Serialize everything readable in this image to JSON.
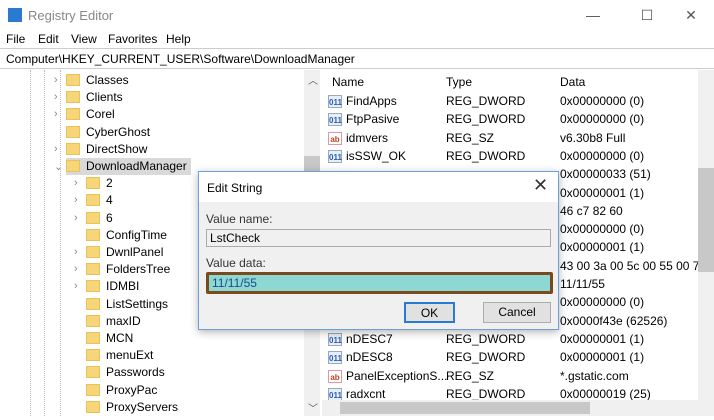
{
  "window": {
    "title": "Registry Editor",
    "minimize": "—",
    "maximize": "☐",
    "close": "✕",
    "icon": "registry-icon"
  },
  "menu": [
    {
      "label": "File"
    },
    {
      "label": "Edit"
    },
    {
      "label": "View"
    },
    {
      "label": "Favorites"
    },
    {
      "label": "Help"
    }
  ],
  "address": "Computer\\HKEY_CURRENT_USER\\Software\\DownloadManager",
  "tree": [
    {
      "label": "Classes",
      "expandable": true
    },
    {
      "label": "Clients",
      "expandable": true
    },
    {
      "label": "Corel",
      "expandable": true
    },
    {
      "label": "CyberGhost",
      "expandable": false
    },
    {
      "label": "DirectShow",
      "expandable": true
    },
    {
      "label": "DownloadManager",
      "expanded": true,
      "selected": true
    },
    {
      "label": "2",
      "expandable": true,
      "child": true
    },
    {
      "label": "4",
      "expandable": true,
      "child": true
    },
    {
      "label": "6",
      "expandable": true,
      "child": true
    },
    {
      "label": "ConfigTime",
      "child": true
    },
    {
      "label": "DwnlPanel",
      "expandable": true,
      "child": true
    },
    {
      "label": "FoldersTree",
      "expandable": true,
      "child": true
    },
    {
      "label": "IDMBI",
      "expandable": true,
      "child": true
    },
    {
      "label": "ListSettings",
      "child": true
    },
    {
      "label": "maxID",
      "child": true
    },
    {
      "label": "MCN",
      "child": true
    },
    {
      "label": "menuExt",
      "child": true
    },
    {
      "label": "Passwords",
      "child": true
    },
    {
      "label": "ProxyPac",
      "child": true
    },
    {
      "label": "ProxyServers",
      "child": true
    }
  ],
  "list": {
    "headers": {
      "name": "Name",
      "type": "Type",
      "data": "Data"
    },
    "rows": [
      {
        "name": "FindApps",
        "type": "REG_DWORD",
        "data": "0x00000000 (0)"
      },
      {
        "name": "FtpPasive",
        "type": "REG_DWORD",
        "data": "0x00000000 (0)"
      },
      {
        "name": "idmvers",
        "type": "REG_SZ",
        "data": "v6.30b8 Full"
      },
      {
        "name": "isSSW_OK",
        "type": "REG_DWORD",
        "data": "0x00000000 (0)"
      },
      {
        "name": "",
        "type": "",
        "data": "0x00000033 (51)"
      },
      {
        "name": "",
        "type": "",
        "data": "0x00000001 (1)"
      },
      {
        "name": "",
        "type": "",
        "data": "46 c7 82 60"
      },
      {
        "name": "",
        "type": "",
        "data": "0x00000000 (0)"
      },
      {
        "name": "",
        "type": "",
        "data": "0x00000001 (1)"
      },
      {
        "name": "",
        "type": "",
        "data": "43 00 3a 00 5c 00 55 00 73 0"
      },
      {
        "name": "",
        "type": "",
        "data": "11/11/55"
      },
      {
        "name": "",
        "type": "",
        "data": "0x00000000 (0)"
      },
      {
        "name": "",
        "type": "",
        "data": "0x0000f43e (62526)"
      },
      {
        "name": "nDESC7",
        "type": "REG_DWORD",
        "data": "0x00000001 (1)"
      },
      {
        "name": "nDESC8",
        "type": "REG_DWORD",
        "data": "0x00000001 (1)"
      },
      {
        "name": "PanelExceptionS...",
        "type": "REG_SZ",
        "data": "*.gstatic.com"
      },
      {
        "name": "radxcnt",
        "type": "REG_DWORD",
        "data": "0x00000019 (25)"
      }
    ]
  },
  "dialog": {
    "title": "Edit String",
    "close": "✕",
    "value_name_label": "Value name:",
    "value_name": "LstCheck",
    "value_data_label": "Value data:",
    "value_data": "11/11/55",
    "ok": "OK",
    "cancel": "Cancel",
    "highlight_color": "#7a4a1c"
  }
}
